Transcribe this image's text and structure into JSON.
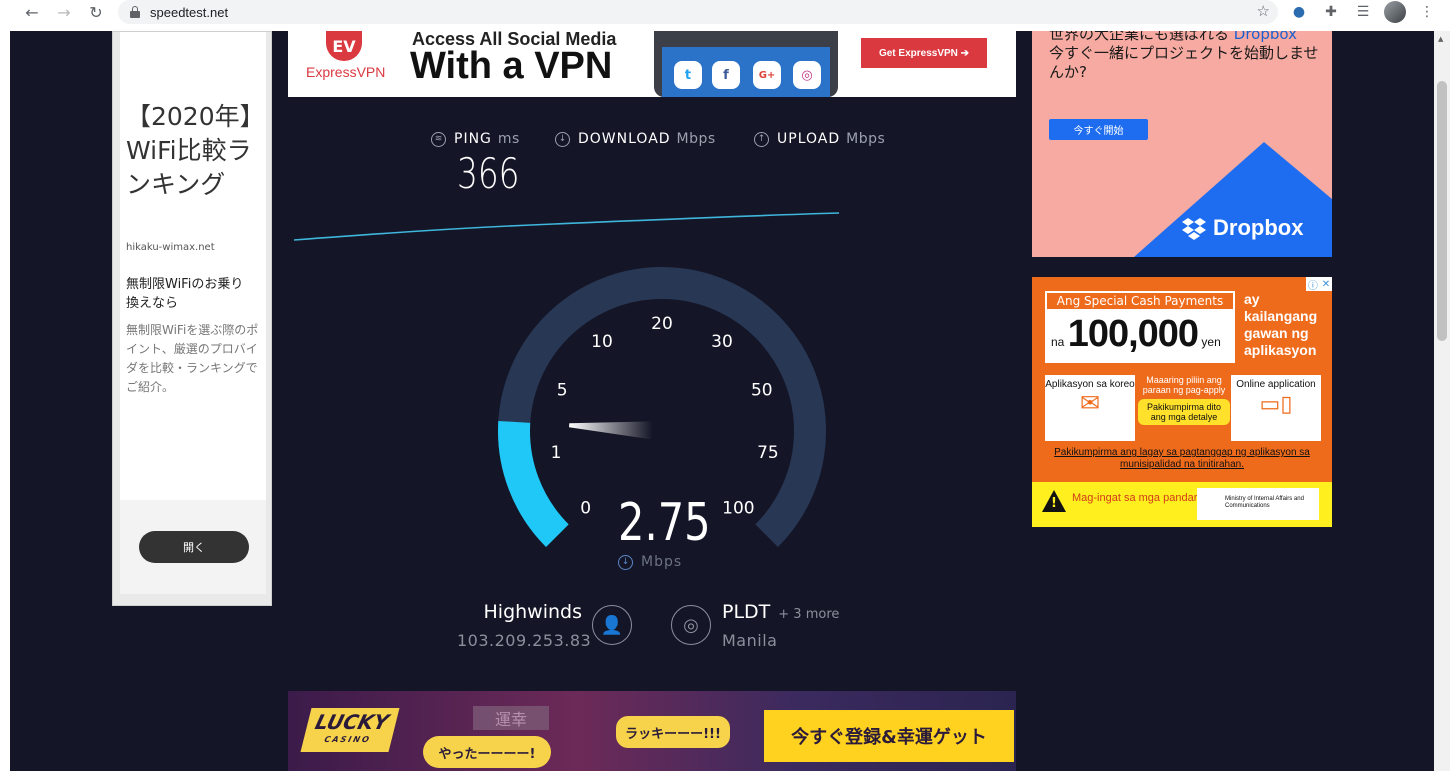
{
  "browser": {
    "url": "speedtest.net",
    "back_icon": "←",
    "forward_icon": "→",
    "reload_icon": "↻",
    "star_icon": "☆",
    "extensions_icon": "✚",
    "menu_icon": "⋮",
    "playlist_icon": "☰"
  },
  "left_ad": {
    "title": "【2020年】WiFi比較ランキング",
    "domain": "hikaku-wimax.net",
    "subtitle": "無制限WiFiのお乗り換えなら",
    "description": "無制限WiFiを選ぶ際のポイント、厳選のプロバイダを比較・ランキングでご紹介。",
    "open_button": "開く"
  },
  "top_banner": {
    "brand_mark": "EV",
    "brand": "ExpressVPN",
    "line1": "Access All Social Media",
    "line2": "With a VPN",
    "social_icons": [
      "t",
      "f",
      "G+",
      "◎"
    ],
    "cta": "Get ExpressVPN ➔"
  },
  "speedtest": {
    "ping_label": "PING",
    "ping_unit": "ms",
    "download_label": "DOWNLOAD",
    "download_unit": "Mbps",
    "upload_label": "UPLOAD",
    "upload_unit": "Mbps",
    "ping_value": "366",
    "speed_value": "2.75",
    "speed_unit": "Mbps",
    "gauge_ticks": [
      "0",
      "1",
      "5",
      "10",
      "20",
      "30",
      "50",
      "75",
      "100"
    ],
    "gauge_level": 2.75,
    "server_name": "Highwinds",
    "server_ip": "103.209.253.83",
    "isp_name": "PLDT",
    "isp_more": "+ 3 more",
    "isp_location": "Manila"
  },
  "dropbox_ad": {
    "line1": "世界の大企業にも選ばれる",
    "line1_brand": "Dropbox",
    "line2": "今すぐ一緒にプロジェクトを始動しませんか?",
    "button": "今すぐ開始",
    "logo": "Dropbox"
  },
  "orange_ad": {
    "tag": "Ang Special Cash Payments",
    "amount_prefix": "na",
    "amount": "100,000",
    "amount_unit": "yen",
    "side_text": "ay kailangang gawan ng aplikasyon",
    "box1": "Aplikasyon sa koreo",
    "mid_text": "Maaaring piliin ang paraan ng pag-apply",
    "mid_highlight": "Pakikumpirma dito ang mga detalye",
    "box2": "Online application",
    "note": "Pakikumpirma ang lagay sa pagtanggap ng aplikasyon sa munisipalidad na tinitirahan.",
    "warning": "Mag-ingat sa mga pandaraya at panloloko!",
    "ministry": "Ministry of Internal Affairs and Communications",
    "close_icons": [
      "ⓘ",
      "✕"
    ]
  },
  "bottom_banner": {
    "logo": "LUCKY",
    "logo_sub": "CASINO",
    "sign": "運幸",
    "bubble1": "やったーーーー!",
    "bubble2": "ラッキーーー!!!",
    "cta": "今すぐ登録&幸運ゲット"
  },
  "colors": {
    "page_bg": "#141526",
    "gauge_track": "#283754",
    "gauge_fill": "#1fc8f6",
    "accent_red": "#da3940",
    "dropbox_blue": "#1e6df0",
    "orange": "#ef6b1c"
  }
}
